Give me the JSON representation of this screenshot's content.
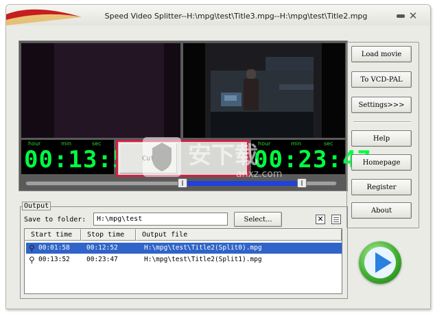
{
  "window": {
    "title": "Speed Video Splitter--H:\\mpg\\test\\Title3.mpg--H:\\mpg\\test\\Title2.mpg"
  },
  "timers": {
    "labels": {
      "hour": "hour",
      "min": "min",
      "sec": "sec"
    },
    "left": "00:13:52",
    "right": "00:23:47"
  },
  "cut": {
    "label": "Cut"
  },
  "slider": {
    "start_fraction": 0.51,
    "end_fraction": 0.88
  },
  "buttons": {
    "load_movie": "Load movie",
    "to_vcd_pal": "To VCD-PAL",
    "settings": "Settings>>>",
    "help": "Help",
    "homepage": "Homepage",
    "register": "Register",
    "about": "About"
  },
  "output": {
    "legend": "Output",
    "save_label": "Save to folder:",
    "folder": "H:\\mpg\\test",
    "select_label": "Select...",
    "clear_symbol": "✕",
    "columns": [
      "Start time",
      "Stop time",
      "Output file"
    ],
    "rows": [
      {
        "start": "00:01:58",
        "stop": "00:12:52",
        "file": "H:\\mpg\\test\\Title2(Split0).mpg",
        "selected": true
      },
      {
        "start": "00:13:52",
        "stop": "00:23:47",
        "file": "H:\\mpg\\test\\Title2(Split1).mpg",
        "selected": false
      }
    ]
  },
  "watermark": {
    "text": "安下载",
    "subtext": "anxz.com"
  },
  "colors": {
    "digits": "#00ff40",
    "cut_border": "#d42040",
    "selection": "#3064c8",
    "range": "#2040e0"
  },
  "icons": [
    "minimize-icon",
    "close-icon",
    "play-icon",
    "pin-icon",
    "list-view-icon"
  ]
}
